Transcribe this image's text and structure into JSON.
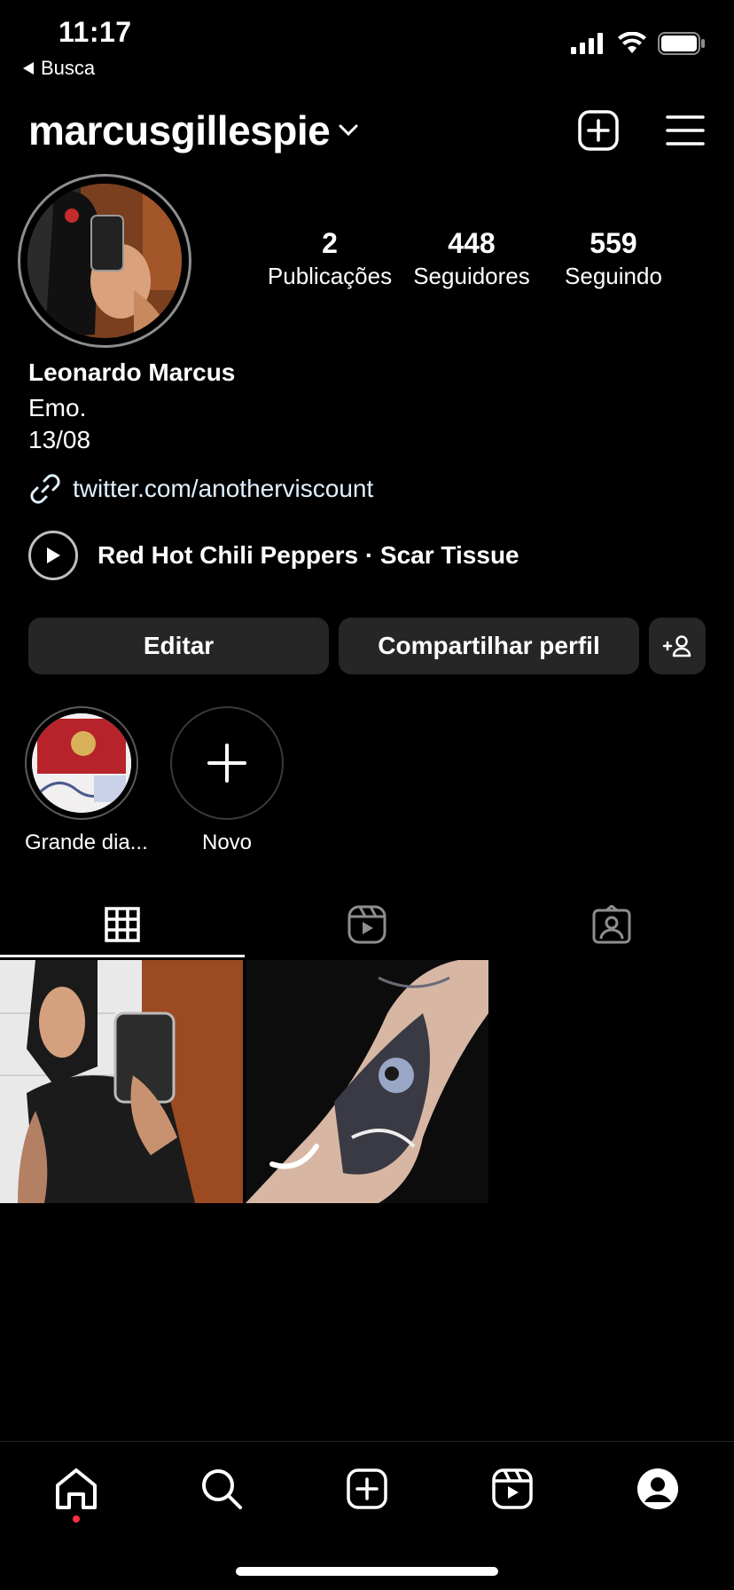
{
  "status_bar": {
    "time": "11:17",
    "back_label": "Busca"
  },
  "header": {
    "username": "marcusgillespie",
    "icons": [
      "chevron-down-icon",
      "create-icon",
      "menu-icon"
    ]
  },
  "profile": {
    "stats": [
      {
        "value": "2",
        "label": "Publicações"
      },
      {
        "value": "448",
        "label": "Seguidores"
      },
      {
        "value": "559",
        "label": "Seguindo"
      }
    ],
    "full_name": "Leonardo Marcus",
    "bio": [
      "Emo.",
      "13/08"
    ],
    "link": "twitter.com/anotherviscount",
    "music": "Red Hot Chili Peppers · Scar Tissue"
  },
  "actions": {
    "edit": "Editar",
    "share": "Compartilhar perfil"
  },
  "highlights": [
    {
      "label": "Grande dia..."
    },
    {
      "label": "Novo"
    }
  ],
  "tabs": [
    "grid-icon",
    "reels-icon",
    "tagged-icon"
  ],
  "bottom_nav": [
    "home-icon",
    "search-icon",
    "create-icon",
    "reels-icon",
    "profile-icon"
  ],
  "colors": {
    "background": "#000000",
    "button_bg": "#262626",
    "notification_dot": "#ff3040",
    "link_text": "#e0f1ff"
  }
}
